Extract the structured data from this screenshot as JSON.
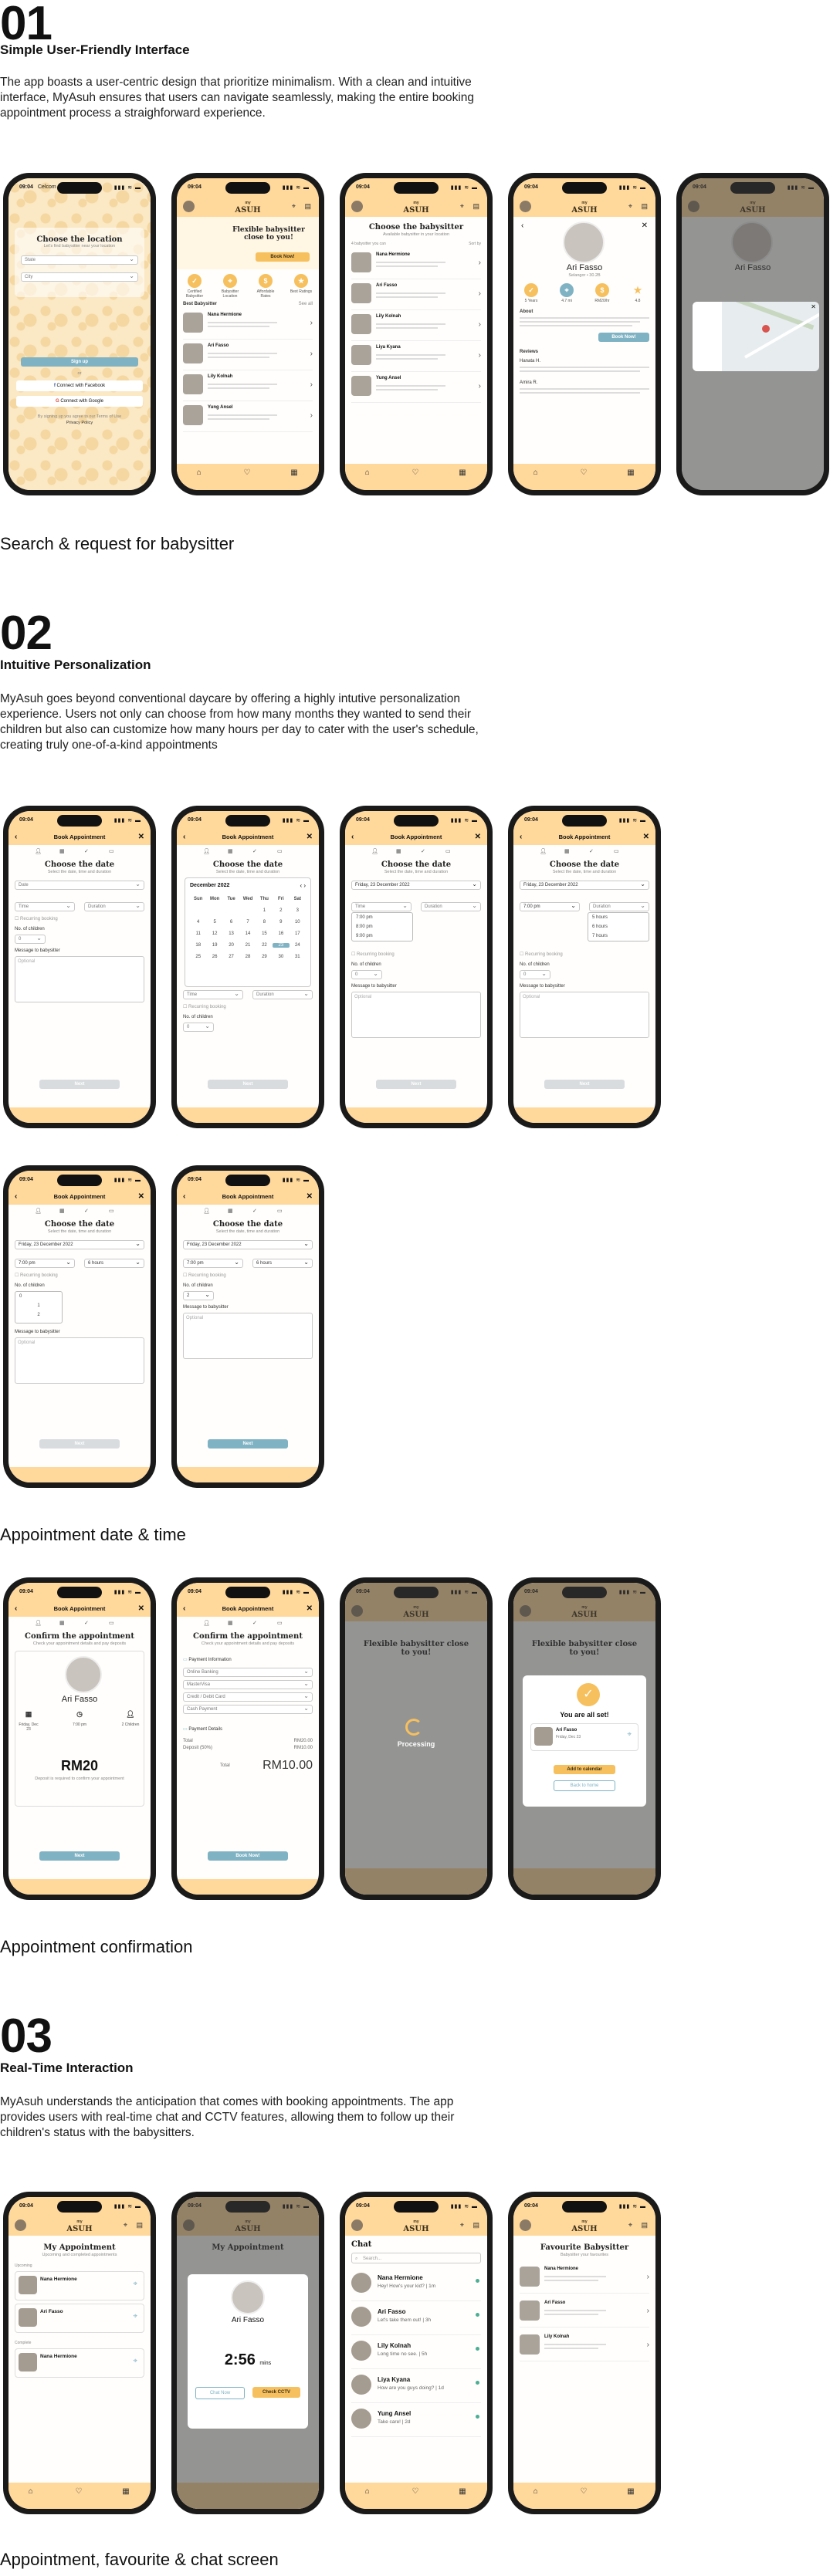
{
  "sections": [
    {
      "number": "01",
      "title": "Simple User-Friendly Interface",
      "description": "The app boasts a user-centric design that prioritize minimalism. With a clean and intuitive interface, MyAsuh ensures that users can navigate seamlessly, making the entire booking appointment process a straighforward experience.",
      "captions": [
        "Search & request for babysitter"
      ]
    },
    {
      "number": "02",
      "title": "Intuitive Personalization",
      "description": "MyAsuh goes beyond conventional daycare by offering a highly intutive personalization experience. Users not only can choose from how many months they wanted to send their children but also can customize how many hours per day to cater with the user's schedule, creating truly one-of-a-kind appointments",
      "captions": [
        "Appointment date & time",
        "Appointment confirmation"
      ]
    },
    {
      "number": "03",
      "title": "Real-Time Interaction",
      "description": "MyAsuh understands the anticipation that comes with booking appointments. The app provides users with real-time chat and CCTV features, allowing them to follow up their children's status with the babysitters.",
      "captions": [
        "Appointment, favourite & chat screen"
      ]
    }
  ],
  "phone": {
    "time": "09:04",
    "carrier": "Celcom",
    "signal": "▮▮▮ ≋ ▬",
    "logo": "ASUH",
    "logo_small": "my",
    "book_title": "Book Appointment",
    "tabs": [
      "Home",
      "Favourite",
      "Book"
    ]
  },
  "location": {
    "title": "Choose the location",
    "subtitle": "Let's find babysitter near your location",
    "state": "State",
    "city": "City",
    "signup": "Sign up",
    "or": "or",
    "facebook": "Connect with Facebook",
    "google": "Connect with Google",
    "terms": "By signing up you agree to our Terms of Use",
    "privacy": "Privacy Policy"
  },
  "home": {
    "banner": "Flexible babysitter close to you!",
    "book_now": "Book Now!",
    "categories": [
      "Certified Babysitter",
      "Babysitter Location",
      "Affordable Rates",
      "Best Ratings"
    ],
    "section": "Best Babysitter",
    "see_all": "See all",
    "sitters": [
      "Nana Hermione",
      "Ari Fasso",
      "Lily Kolnah",
      "Yung Ansel"
    ]
  },
  "search": {
    "title": "Choose the babysitter",
    "subtitle": "Available babysitter in your location",
    "available": "4 babysitter you can",
    "sort": "Sort by",
    "sitters": [
      "Nana Hermione",
      "Ari Fasso",
      "Lily Kolnah",
      "Liya Kyana",
      "Yung Ansel"
    ]
  },
  "profile": {
    "name": "Ari Fasso",
    "sub": "Selangor • 30.2B",
    "stats": [
      "5 Years",
      "4.7 mi",
      "RM20/hr",
      "4.8"
    ],
    "about": "About",
    "book_now": "Book Now!",
    "reviews": "Reviews",
    "reviewers": [
      "Hanata H.",
      "Amira R."
    ]
  },
  "date_time": {
    "title": "Choose the date",
    "subtitle": "Select the date, time and duration",
    "date": "Date",
    "date_selected": "Friday, 23 December 2022",
    "time": "Time",
    "time_selected": "7:00 pm",
    "duration": "Duration",
    "duration_selected": "6 hours",
    "recurring": "Recurring booking",
    "children": "No. of children",
    "children_value": "0",
    "children_value2": "2",
    "message": "Message to babysitter",
    "optional": "Optional",
    "next": "Next",
    "calendar_month": "December 2022",
    "weekdays": [
      "Sun",
      "Mon",
      "Tue",
      "Wed",
      "Thu",
      "Fri",
      "Sat"
    ],
    "days": [
      "",
      "",
      "",
      "",
      "1",
      "2",
      "3",
      "4",
      "5",
      "6",
      "7",
      "8",
      "9",
      "10",
      "11",
      "12",
      "13",
      "14",
      "15",
      "16",
      "17",
      "18",
      "19",
      "20",
      "21",
      "22",
      "23",
      "24",
      "25",
      "26",
      "27",
      "28",
      "29",
      "30",
      "31"
    ],
    "selected_day": "23",
    "time_options": [
      "7:00 pm",
      "8:00 pm",
      "9:00 pm"
    ],
    "duration_options": [
      "5 hours",
      "6 hours",
      "7 hours"
    ]
  },
  "confirm": {
    "title": "Confirm the appointment",
    "subtitle": "Check your appointment details and pay deposits",
    "name": "Ari Fasso",
    "details": [
      "Friday, Dec 23",
      "7:00 pm",
      "2 Children"
    ],
    "price": "RM20",
    "price_note": "Deposit is required to confirm your appointment",
    "next": "Next",
    "payment_info": "Payment Information",
    "payment_options": [
      "Online Banking",
      "MasterVisa",
      "Credit / Debit Card",
      "Cash Payment"
    ],
    "payment_details": "Payment Details",
    "subtotal_label": "Total",
    "subtotal": "RM20.00",
    "deposit_label": "Deposit (50%)",
    "deposit": "RM10.00",
    "total_label": "Total",
    "total": "RM10.00",
    "book_now": "Book Now!",
    "processing": "Processing",
    "all_set": "You are all set!",
    "add_calendar": "Add to calendar",
    "back_home": "Back to home"
  },
  "appointments": {
    "title": "My Appointment",
    "subtitle": "Upcoming and completed appointments",
    "upcoming": "Upcoming",
    "complete": "Complete",
    "items": [
      "Nana Hermione",
      "Ari Fasso",
      "Nana Hermione"
    ]
  },
  "cctv": {
    "name": "Ari Fasso",
    "timer": "2:56",
    "timer_unit": "mins",
    "chat": "Chat Now",
    "check": "Check CCTV"
  },
  "chat": {
    "title": "Chat",
    "search": "Search...",
    "items": [
      {
        "name": "Nana Hermione",
        "msg": "Hey! How's your kid? | 1m"
      },
      {
        "name": "Ari Fasso",
        "msg": "Let's take them out! | 3h"
      },
      {
        "name": "Lily Kolnah",
        "msg": "Long time no see. | 5h"
      },
      {
        "name": "Liya Kyana",
        "msg": "How are you guys doing? | 1d"
      },
      {
        "name": "Yung Ansel",
        "msg": "Take care! | 2d"
      }
    ]
  },
  "favourite": {
    "title": "Favourite Babysitter",
    "subtitle": "Babysitter your favourites",
    "items": [
      "Nana Hermione",
      "Ari Fasso",
      "Lily Kolnah"
    ]
  }
}
